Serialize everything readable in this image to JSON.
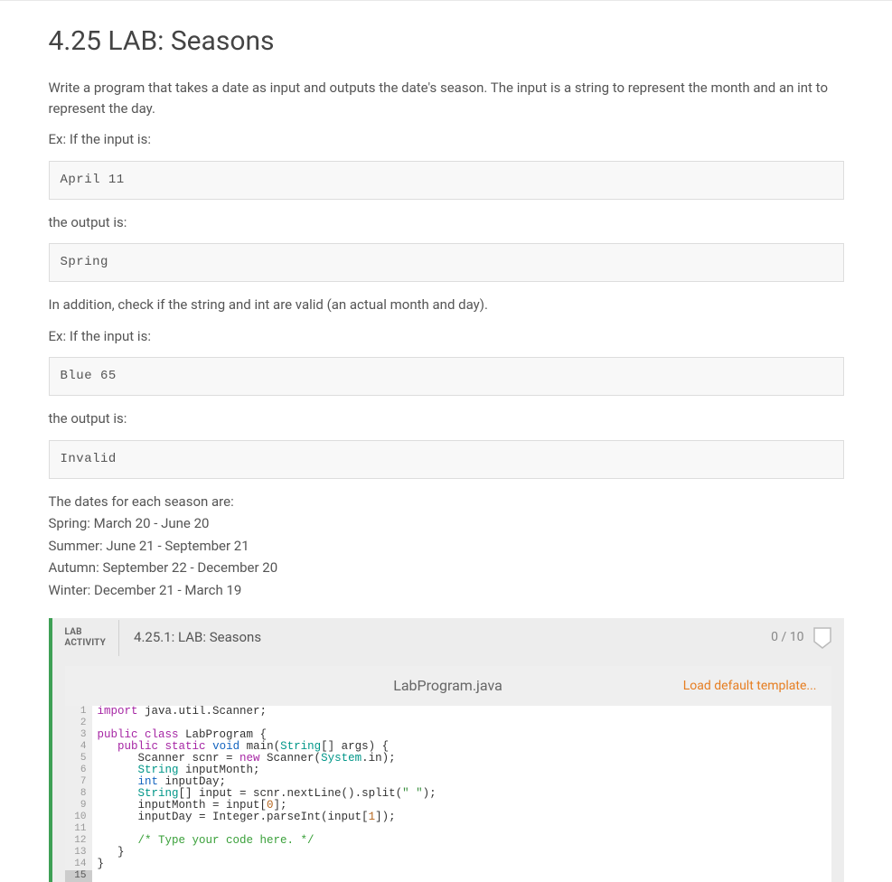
{
  "title": "4.25 LAB: Seasons",
  "intro": "Write a program that takes a date as input and outputs the date's season. The input is a string to represent the month and an int to represent the day.",
  "ex_if_input": "Ex: If the input is:",
  "example1_input": "April 11",
  "the_output_is": "the output is:",
  "example1_output": "Spring",
  "addition": "In addition, check if the string and int are valid (an actual month and day).",
  "example2_input": "Blue 65",
  "example2_output": "Invalid",
  "seasons_heading": "The dates for each season are:",
  "seasons": {
    "spring": "Spring: March 20 - June 20",
    "summer": "Summer: June 21 - September 21",
    "autumn": "Autumn: September 22 - December 20",
    "winter": "Winter: December 21 - March 19"
  },
  "activity": {
    "tag_line1": "LAB",
    "tag_line2": "ACTIVITY",
    "title": "4.25.1: LAB: Seasons",
    "score": "0 / 10"
  },
  "editor": {
    "filename": "LabProgram.java",
    "action": "Load default template..."
  },
  "code": {
    "l1": "import java.util.Scanner;",
    "l2": "",
    "l3": "public class LabProgram {",
    "l4": "   public static void main(String[] args) {",
    "l5": "      Scanner scnr = new Scanner(System.in);",
    "l6": "      String inputMonth;",
    "l7": "      int inputDay;",
    "l8": "      String[] input = scnr.nextLine().split(\" \");",
    "l9": "      inputMonth = input[0];",
    "l10": "      inputDay = Integer.parseInt(input[1]);",
    "l11": "",
    "l12": "      /* Type your code here. */",
    "l13": "   }",
    "l14": "}",
    "l15": ""
  }
}
